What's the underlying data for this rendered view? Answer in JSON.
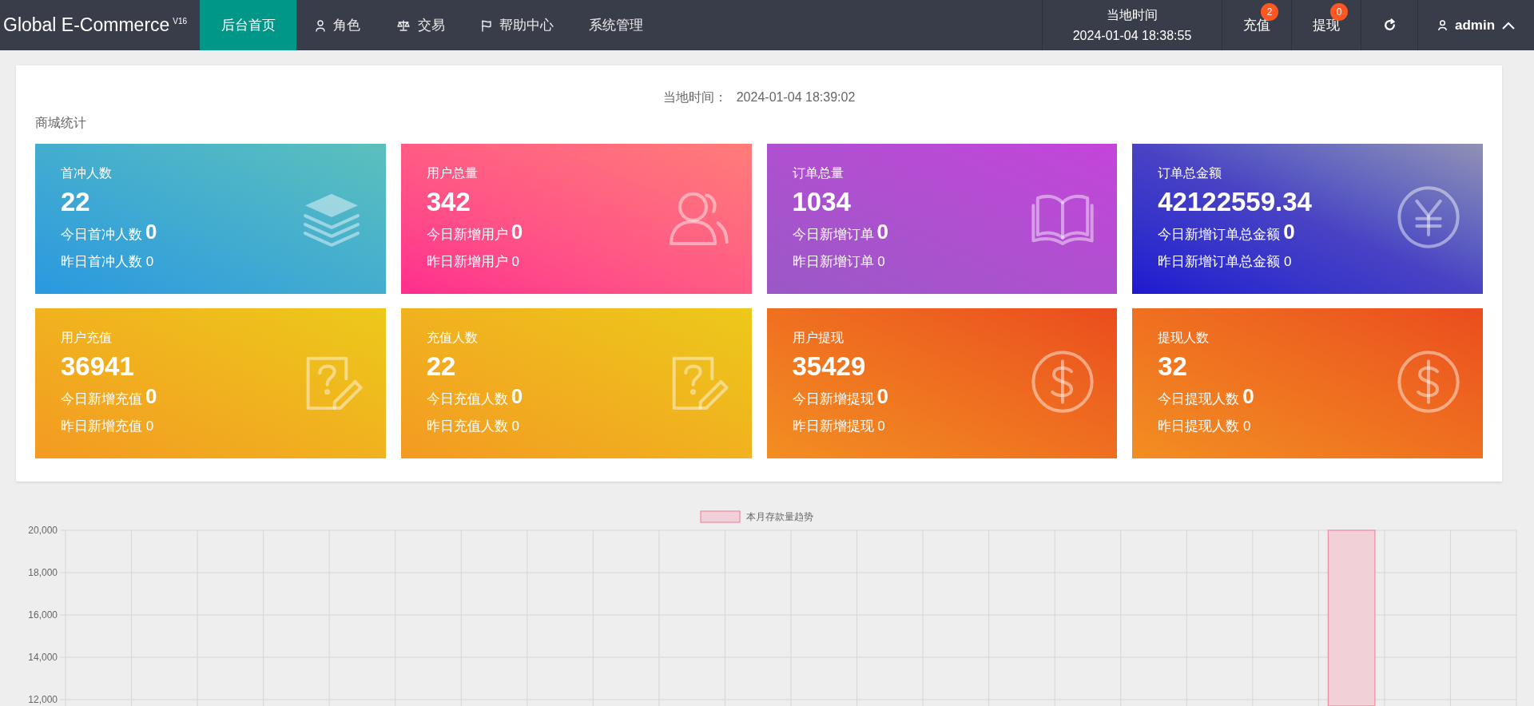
{
  "topbar": {
    "logo": "Global E-Commerce",
    "version": "V16",
    "nav": [
      {
        "label": "后台首页",
        "selected": true
      },
      {
        "label": "角色",
        "selected": false
      },
      {
        "label": "交易",
        "selected": false
      },
      {
        "label": "帮助中心",
        "selected": false
      },
      {
        "label": "系统管理",
        "selected": false
      }
    ],
    "clock": {
      "label": "当地时间",
      "value": "2024-01-04 18:38:55"
    },
    "actions": [
      {
        "label": "充值",
        "badge": "2"
      },
      {
        "label": "提现",
        "badge": "0"
      }
    ],
    "user": "admin"
  },
  "stats": {
    "time_label": "当地时间：",
    "time_value": "2024-01-04 18:39:02",
    "title": "商城统计",
    "cards": [
      {
        "title": "首冲人数",
        "value": "22",
        "today_label": "今日首冲人数",
        "today_value": "0",
        "yesterday": "昨日首冲人数 0"
      },
      {
        "title": "用户总量",
        "value": "342",
        "today_label": "今日新增用户",
        "today_value": "0",
        "yesterday": "昨日新增用户 0"
      },
      {
        "title": "订单总量",
        "value": "1034",
        "today_label": "今日新增订单",
        "today_value": "0",
        "yesterday": "昨日新增订单 0"
      },
      {
        "title": "订单总金额",
        "value": "42122559.34",
        "today_label": "今日新增订单总金额",
        "today_value": "0",
        "yesterday": "昨日新增订单总金额 0"
      },
      {
        "title": "用户充值",
        "value": "36941",
        "today_label": "今日新增充值",
        "today_value": "0",
        "yesterday": "昨日新增充值 0"
      },
      {
        "title": "充值人数",
        "value": "22",
        "today_label": "今日充值人数",
        "today_value": "0",
        "yesterday": "昨日充值人数 0"
      },
      {
        "title": "用户提现",
        "value": "35429",
        "today_label": "今日新增提现",
        "today_value": "0",
        "yesterday": "昨日新增提现 0"
      },
      {
        "title": "提现人数",
        "value": "32",
        "today_label": "今日提现人数",
        "today_value": "0",
        "yesterday": "昨日提现人数 0"
      }
    ]
  },
  "trend": {
    "chart_data": {
      "type": "bar",
      "ylim": [
        12000,
        20000
      ],
      "grid": true,
      "yticks": [
        {
          "value": 12000,
          "label": "12,000"
        },
        {
          "value": 14000,
          "label": "14,000"
        },
        {
          "value": 16000,
          "label": "16,000"
        },
        {
          "value": 18000,
          "label": "18,000"
        },
        {
          "value": 20000,
          "label": "20,000"
        }
      ],
      "series": [
        {
          "name": "本月存款量趋势",
          "color": "#f08aa0",
          "values": [
            null,
            null,
            null,
            null,
            null,
            null,
            null,
            null,
            null,
            null,
            null,
            null,
            null,
            null,
            null,
            null,
            null,
            null,
            null,
            20000,
            null,
            null
          ]
        }
      ]
    }
  }
}
